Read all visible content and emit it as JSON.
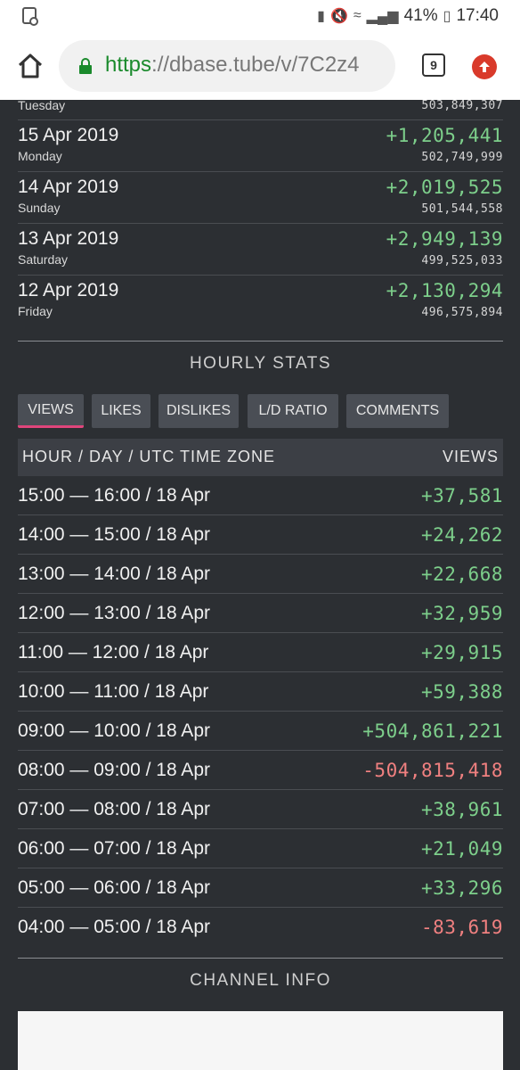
{
  "statusbar": {
    "battery": "41%",
    "time": "17:40"
  },
  "browser": {
    "url_scheme": "https",
    "url_rest": "://dbase.tube/v/7C2z4",
    "tab_count": "9"
  },
  "daily": {
    "partial_row": {
      "day": "Tuesday",
      "total": "503,849,307"
    },
    "rows": [
      {
        "date": "15 Apr 2019",
        "day": "Monday",
        "delta": "+1,205,441",
        "total": "502,749,999"
      },
      {
        "date": "14 Apr 2019",
        "day": "Sunday",
        "delta": "+2,019,525",
        "total": "501,544,558"
      },
      {
        "date": "13 Apr 2019",
        "day": "Saturday",
        "delta": "+2,949,139",
        "total": "499,525,033"
      },
      {
        "date": "12 Apr 2019",
        "day": "Friday",
        "delta": "+2,130,294",
        "total": "496,575,894"
      }
    ]
  },
  "hourly": {
    "title": "HOURLY STATS",
    "tabs": [
      "VIEWS",
      "LIKES",
      "DISLIKES",
      "L/D RATIO",
      "COMMENTS"
    ],
    "header_left": "HOUR / DAY / UTC TIME ZONE",
    "header_right": "VIEWS",
    "rows": [
      {
        "label": "15:00 — 16:00 / 18 Apr",
        "value": "+37,581"
      },
      {
        "label": "14:00 — 15:00 / 18 Apr",
        "value": "+24,262"
      },
      {
        "label": "13:00 — 14:00 / 18 Apr",
        "value": "+22,668"
      },
      {
        "label": "12:00 — 13:00 / 18 Apr",
        "value": "+32,959"
      },
      {
        "label": "11:00 — 12:00 / 18 Apr",
        "value": "+29,915"
      },
      {
        "label": "10:00 — 11:00 / 18 Apr",
        "value": "+59,388"
      },
      {
        "label": "09:00 — 10:00 / 18 Apr",
        "value": "+504,861,221"
      },
      {
        "label": "08:00 — 09:00 / 18 Apr",
        "value": "-504,815,418"
      },
      {
        "label": "07:00 — 08:00 / 18 Apr",
        "value": "+38,961"
      },
      {
        "label": "06:00 — 07:00 / 18 Apr",
        "value": "+21,049"
      },
      {
        "label": "05:00 — 06:00 / 18 Apr",
        "value": "+33,296"
      },
      {
        "label": "04:00 — 05:00 / 18 Apr",
        "value": "-83,619"
      }
    ]
  },
  "channel": {
    "title": "CHANNEL INFO"
  },
  "colors": {
    "positive": "#7dcf8b",
    "negative": "#f08080",
    "active_tab_underline": "#e0457b",
    "secure_green": "#1a8a2c"
  },
  "icons": [
    "image-notification-icon",
    "battery-saver-icon",
    "mute-icon",
    "wifi-icon",
    "signal-icon",
    "home-icon",
    "lock-icon",
    "tab-switcher-icon",
    "update-icon"
  ]
}
